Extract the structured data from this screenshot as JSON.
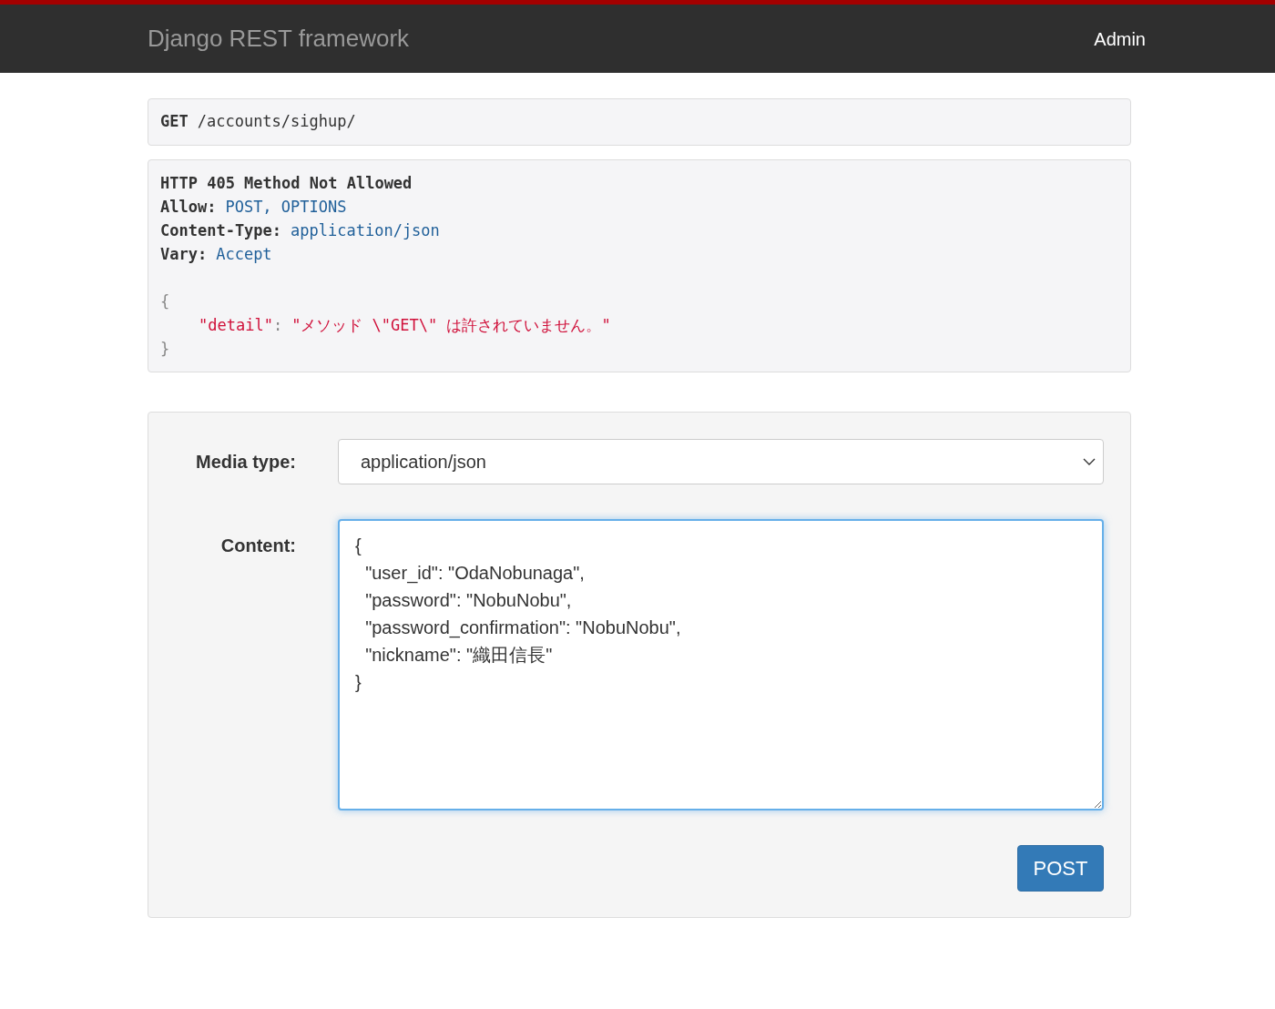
{
  "navbar": {
    "brand": "Django REST framework",
    "user": "Admin"
  },
  "request": {
    "method": "GET",
    "path": "/accounts/sighup/"
  },
  "response": {
    "status": "HTTP 405 Method Not Allowed",
    "headers": [
      {
        "name": "Allow:",
        "value": "POST, OPTIONS"
      },
      {
        "name": "Content-Type:",
        "value": "application/json"
      },
      {
        "name": "Vary:",
        "value": "Accept"
      }
    ],
    "body": {
      "open": "{",
      "key": "\"detail\"",
      "colon": ":",
      "value": "\"メソッド \\\"GET\\\" は許されていません。\"",
      "close": "}"
    }
  },
  "form": {
    "media_type": {
      "label": "Media type:",
      "value": "application/json"
    },
    "content": {
      "label": "Content:",
      "focused": true,
      "value": "{\n  \"user_id\": \"OdaNobunaga\",\n  \"password\": \"NobuNobu\",\n  \"password_confirmation\": \"NobuNobu\",\n  \"nickname\": \"織田信長\"\n}"
    },
    "submit": "POST"
  }
}
